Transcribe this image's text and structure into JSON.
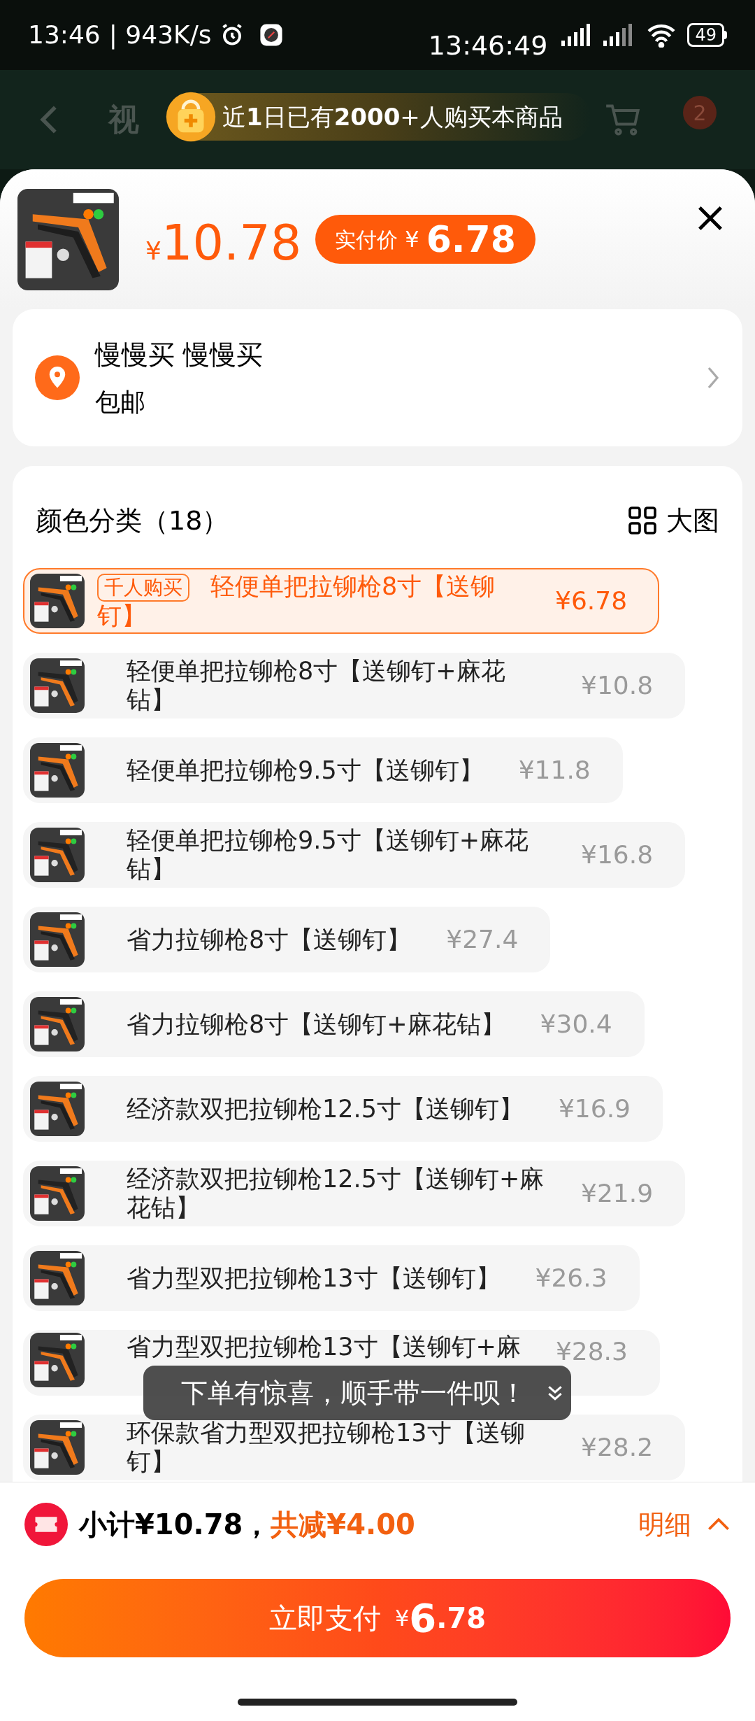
{
  "status_bar": {
    "time": "13:46",
    "speed": "| 943K/s",
    "clock": "13:46:49",
    "battery": "49"
  },
  "header": {
    "title": "视",
    "cart_badge": "2",
    "banner": "近**1**日已有**2000**+人购买本商品"
  },
  "product": {
    "currency": "¥",
    "price": "10.78",
    "final_label": "实付价",
    "final_currency": "¥",
    "final_price": "6.78"
  },
  "address": {
    "name": "慢慢买 慢慢买",
    "shipping": "包邮"
  },
  "variants": {
    "title": "颜色分类（18）",
    "view_toggle": "大图",
    "items": [
      {
        "badge": "千人购买",
        "name": "轻便单把拉铆枪8寸【送铆钉】",
        "price": "¥6.78",
        "selected": true
      },
      {
        "name": "轻便单把拉铆枪8寸【送铆钉+麻花钻】",
        "price": "¥10.8",
        "selected": false
      },
      {
        "name": "轻便单把拉铆枪9.5寸【送铆钉】",
        "price": "¥11.8",
        "selected": false
      },
      {
        "name": "轻便单把拉铆枪9.5寸【送铆钉+麻花钻】",
        "price": "¥16.8",
        "selected": false
      },
      {
        "name": "省力拉铆枪8寸【送铆钉】",
        "price": "¥27.4",
        "selected": false
      },
      {
        "name": "省力拉铆枪8寸【送铆钉+麻花钻】",
        "price": "¥30.4",
        "selected": false
      },
      {
        "name": "经济款双把拉铆枪12.5寸【送铆钉】",
        "price": "¥16.9",
        "selected": false
      },
      {
        "name": "经济款双把拉铆枪12.5寸【送铆钉+麻花钻】",
        "price": "¥21.9",
        "selected": false
      },
      {
        "name": "省力型双把拉铆枪13寸【送铆钉】",
        "price": "¥26.3",
        "selected": false
      },
      {
        "name": "省力型双把拉铆枪13寸【送铆钉+麻",
        "price": "¥28.3",
        "selected": false,
        "covered": true
      },
      {
        "name": "环保款省力型双把拉铆枪13寸【送铆钉】",
        "price": "¥28.2",
        "selected": false
      }
    ]
  },
  "toast": "下单有惊喜，顺手带一件呗！",
  "summary": {
    "subtotal": "小计¥10.78，",
    "discount": "共减¥4.00",
    "details": "明细"
  },
  "pay_button": {
    "label": "立即支付",
    "currency": "¥",
    "amount_int": "6",
    "amount_dec": ".78"
  }
}
